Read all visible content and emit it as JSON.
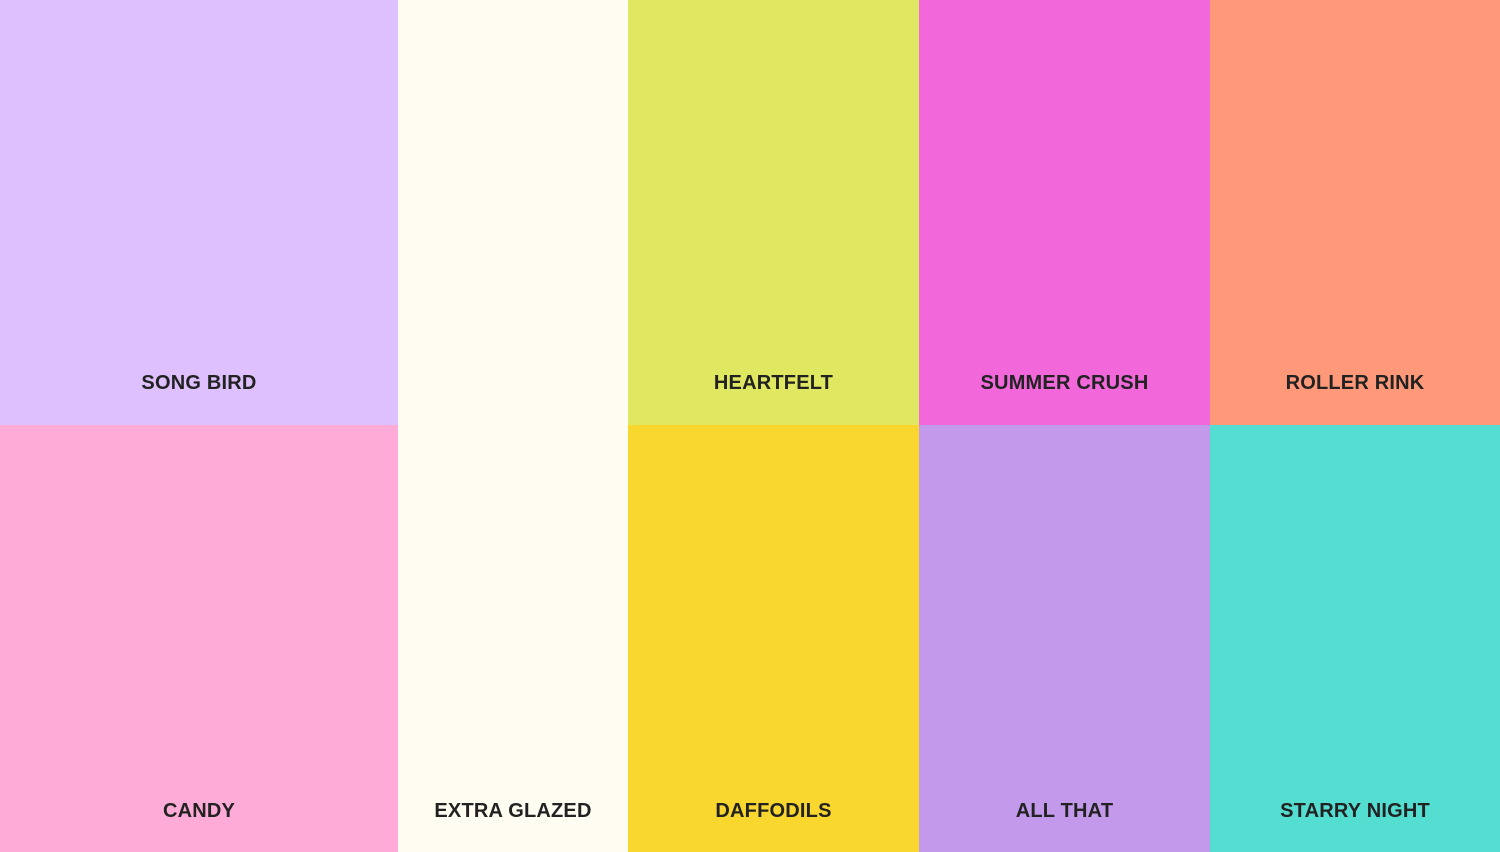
{
  "swatches": {
    "song_bird": {
      "name": "SONG BIRD",
      "color": "#DDC0FD"
    },
    "candy": {
      "name": "CANDY",
      "color": "#FEABD8"
    },
    "extra_glazed": {
      "name": "EXTRA GLAZED",
      "color": "#FFFDF1"
    },
    "heartfelt": {
      "name": "HEARTFELT",
      "color": "#E0E861"
    },
    "daffodils": {
      "name": "DAFFODILS",
      "color": "#FAD72E"
    },
    "summer_crush": {
      "name": "SUMMER CRUSH",
      "color": "#F268DB"
    },
    "all_that": {
      "name": "ALL THAT",
      "color": "#C299EB"
    },
    "roller_rink": {
      "name": "ROLLER RINK",
      "color": "#FF9979"
    },
    "starry_night": {
      "name": "STARRY NIGHT",
      "color": "#54DDD1"
    }
  }
}
